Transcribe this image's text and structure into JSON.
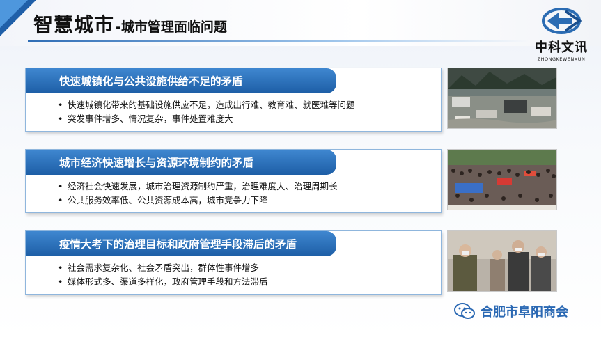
{
  "header": {
    "title_main": "智慧城市",
    "title_sub": "-城市管理面临问题"
  },
  "logo": {
    "name": "中科文讯",
    "pinyin": "ZHONGKEWENXUN"
  },
  "panels": [
    {
      "heading": "快速城镇化与公共设施供给不足的矛盾",
      "bullets": [
        "快速城镇化带来的基础设施供应不足，造成出行难、教育难、就医难等问题",
        "突发事件增多、情况复杂，事件处置难度大"
      ],
      "image": "flooded-street-photo"
    },
    {
      "heading": "城市经济快速增长与资源环境制约的矛盾",
      "bullets": [
        "经济社会快速发展，城市治理资源制约严重，治理难度大、治理周期长",
        "公共服务效率低、公共资源成本高，城市竞争力下降"
      ],
      "image": "crowd-gathering-photo"
    },
    {
      "heading": "疫情大考下的治理目标和政府管理手段滞后的矛盾",
      "bullets": [
        "社会需求复杂化、社会矛盾突出，群体性事件增多",
        "媒体形式多、渠道多样化，政府管理手段和方法滞后"
      ],
      "image": "masked-pedestrians-photo"
    }
  ],
  "watermark": {
    "text": "合肥市阜阳商会",
    "icon": "wechat-icon"
  },
  "colors": {
    "accent": "#1d5ea6",
    "accent_light": "#3f87d0",
    "border": "#8fb6dd"
  }
}
